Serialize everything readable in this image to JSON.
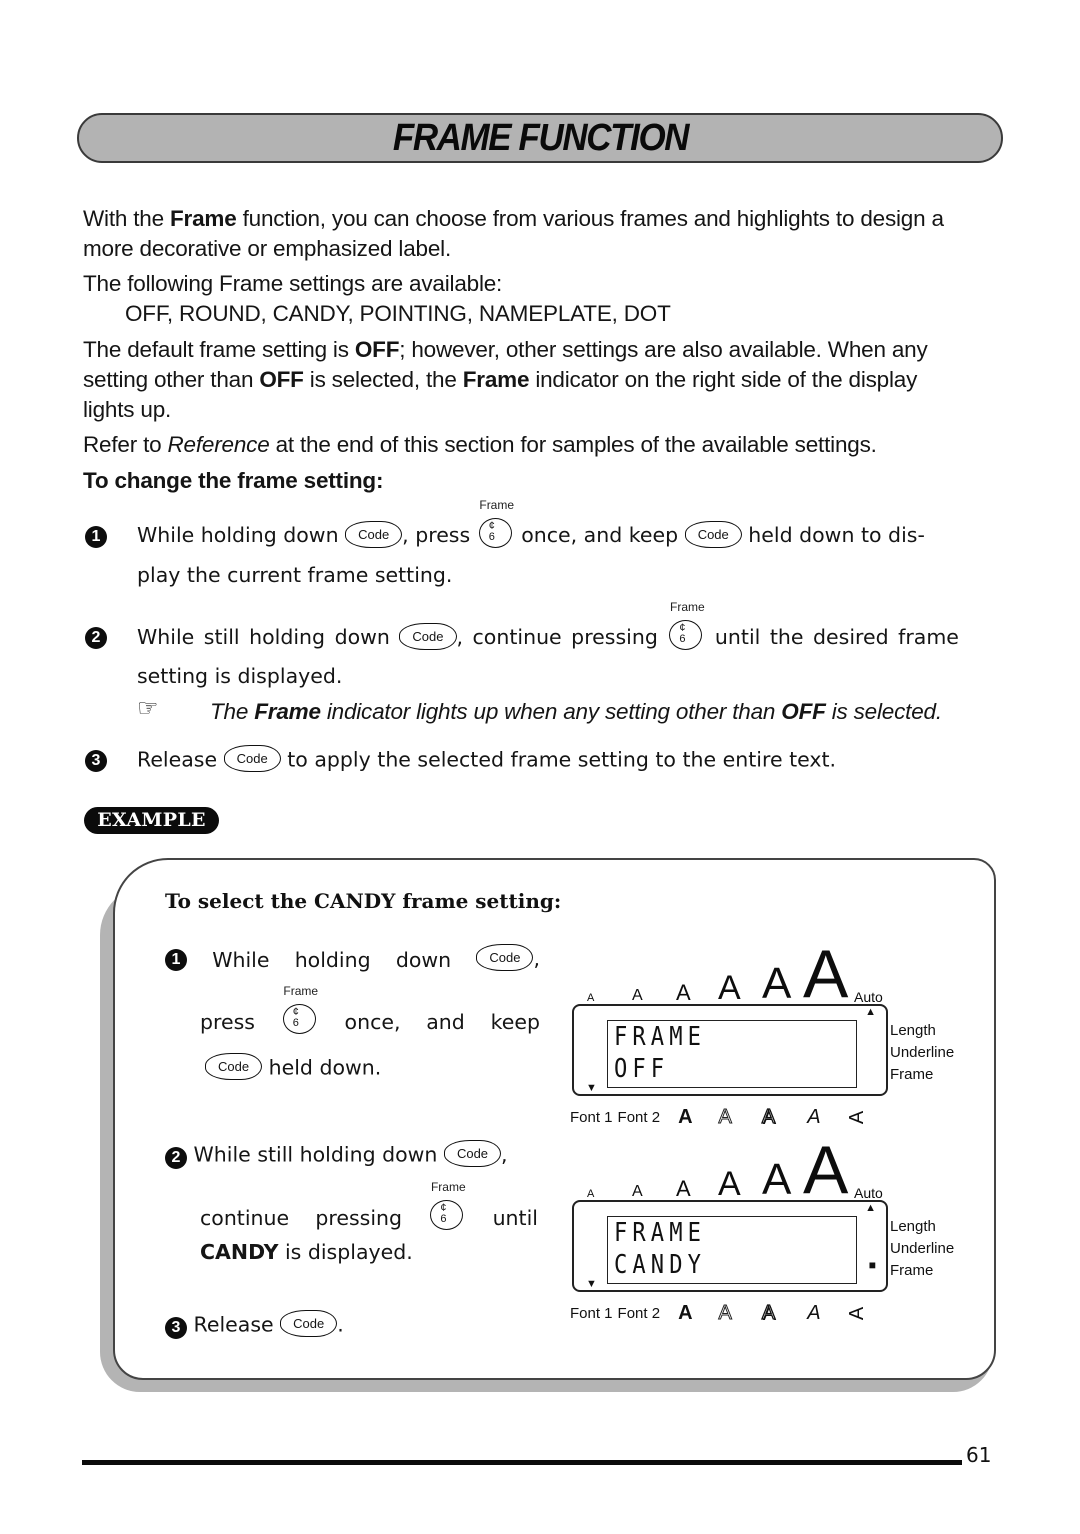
{
  "page": {
    "title": "FRAME FUNCTION",
    "page_number": "61"
  },
  "intro": {
    "p1_a": "With the ",
    "p1_bold": "Frame",
    "p1_b": " function, you can choose from various frames and highlights to design a",
    "p1_c": "more decorative or emphasized label.",
    "p2": "The following Frame settings are available:",
    "settings_list": "OFF, ROUND, CANDY, POINTING, NAMEPLATE, DOT",
    "p3_a": "The default frame setting is ",
    "p3_b1": "OFF",
    "p3_b": "; however, other settings are also available. When any",
    "p3_c": "setting other than ",
    "p3_b2": "OFF",
    "p3_d": " is selected, the ",
    "p3_b3": "Frame",
    "p3_e": " indicator on the right side of the display",
    "p3_f": "lights up.",
    "p4_a": "Refer to ",
    "p4_italic": "Reference",
    "p4_b": " at the end of this section for samples of the available settings."
  },
  "procedure": {
    "heading": "To change the frame setting:",
    "steps": [
      {
        "number": "1",
        "t1": "While holding down",
        "t2": ", press",
        "t3": "once, and keep",
        "t4": "held down to dis-",
        "t5": "play the current frame setting."
      },
      {
        "number": "2",
        "t1": "While still holding down",
        "t2": ", continue pressing",
        "t3": "until the desired frame",
        "t4": "setting is displayed."
      },
      {
        "number": "3",
        "t1": "Release",
        "t2": "to apply the selected frame setting to the entire text."
      }
    ],
    "note_a": "The ",
    "note_bold1": "Frame",
    "note_b": " indicator lights up when any setting other than ",
    "note_bold2": "OFF",
    "note_c": " is selected."
  },
  "keys": {
    "code": "Code",
    "frame_label": "Frame",
    "frame_glyph_top": "¢",
    "frame_glyph_bottom": "6"
  },
  "example": {
    "badge": "EXAMPLE",
    "heading": "To select the CANDY frame setting:",
    "step1": {
      "number": "1",
      "a": "While",
      "b": "holding",
      "c": "down",
      "comma": ",",
      "d": "press",
      "e": "once,",
      "f": "and",
      "g": "keep",
      "h": "held down."
    },
    "step2": {
      "number": "2",
      "a": "While still holding down",
      "comma": ",",
      "b": "continue",
      "c": "pressing",
      "d": "until",
      "bold": "CANDY",
      "e": " is displayed."
    },
    "step3": {
      "number": "3",
      "a": "Release",
      "period": "."
    }
  },
  "lcd": {
    "size_glyph": "A",
    "auto_label": "Auto",
    "side_labels": [
      "Length",
      "Underline",
      "Frame"
    ],
    "font1": "Font 1",
    "font2": "Font 2",
    "style_glyphs": [
      "A",
      "A",
      "A",
      "A",
      "A"
    ],
    "up_arrow": "▲",
    "down_arrow": "▼",
    "indicator": "■",
    "displays": [
      {
        "line1": "FRAME",
        "line2": "OFF",
        "frame_indicator_on": false
      },
      {
        "line1": "FRAME",
        "line2": "CANDY",
        "frame_indicator_on": true
      }
    ]
  },
  "icons": {
    "hand_pointer": "☞"
  }
}
